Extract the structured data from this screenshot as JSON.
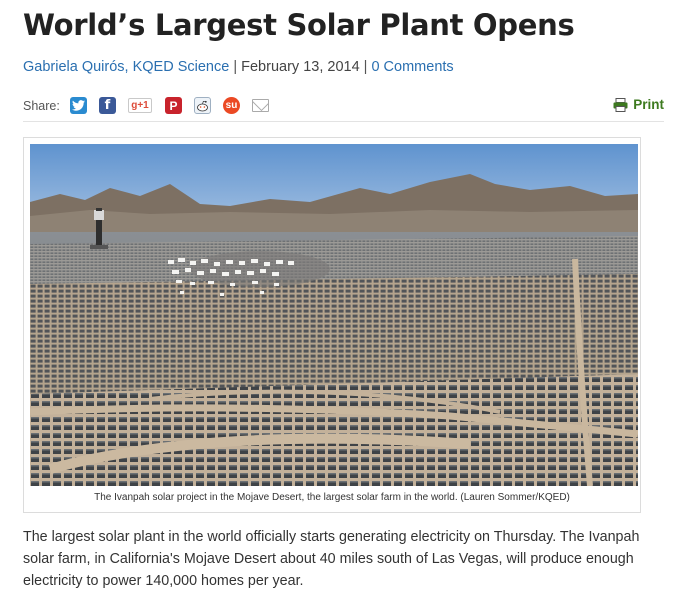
{
  "article": {
    "title": "World’s Largest Solar Plant Opens",
    "author": "Gabriela Quirós, KQED Science",
    "separator_1": " | ",
    "date": "February 13, 2014",
    "separator_2": " | ",
    "comments_link": "0 Comments"
  },
  "share": {
    "label": "Share:",
    "icons": [
      "twitter-icon",
      "facebook-icon",
      "google-plus-icon",
      "pinterest-icon",
      "reddit-icon",
      "stumbleupon-icon",
      "email-icon"
    ],
    "gplus_text": "g+1",
    "facebook_glyph": "f",
    "pinterest_glyph": "P",
    "stumble_glyph": "su"
  },
  "print": {
    "label": "Print"
  },
  "figure": {
    "caption": "The Ivanpah solar project in the Mojave Desert, the largest solar farm in the world. (Lauren Sommer/KQED)"
  },
  "body": {
    "paragraph_1": "The largest solar plant in the world officially starts generating electricity on Thursday. The Ivanpah solar farm, in California's Mojave Desert about 40 miles south of Las Vegas, will produce enough electricity to power 140,000 homes per year."
  },
  "colors": {
    "link": "#2a6fb0",
    "print": "#3d7a1f",
    "sky": "#6f9fd4",
    "desert": "#b9a58a"
  }
}
